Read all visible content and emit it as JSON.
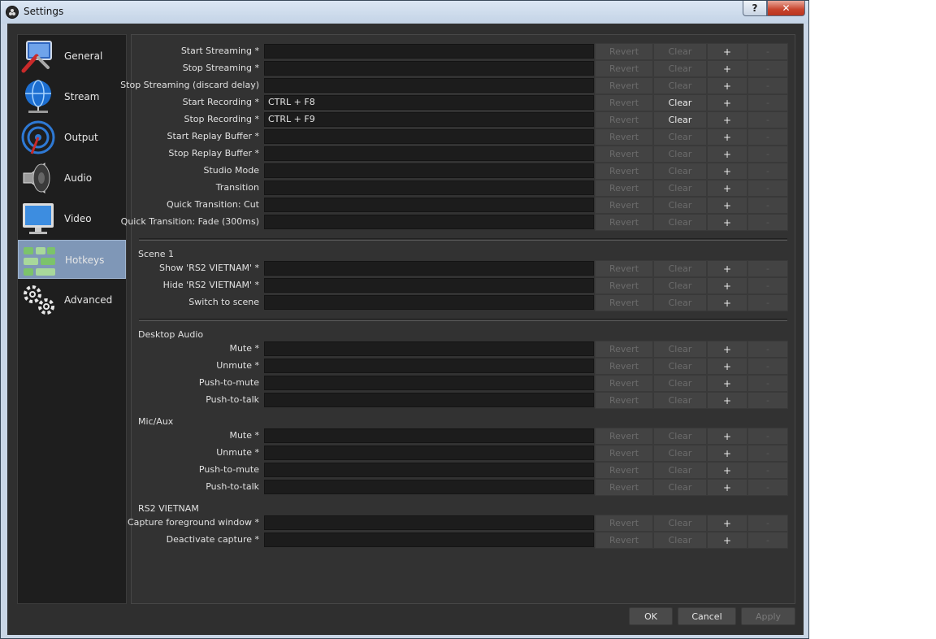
{
  "window": {
    "title": "Settings",
    "help_glyph": "?",
    "close_glyph": "✕"
  },
  "sidebar": {
    "items": [
      {
        "label": "General",
        "icon": "general-icon"
      },
      {
        "label": "Stream",
        "icon": "globe-icon"
      },
      {
        "label": "Output",
        "icon": "output-icon"
      },
      {
        "label": "Audio",
        "icon": "speaker-icon"
      },
      {
        "label": "Video",
        "icon": "monitor-icon"
      },
      {
        "label": "Hotkeys",
        "icon": "hotkeys-icon"
      },
      {
        "label": "Advanced",
        "icon": "gears-icon"
      }
    ],
    "selected": "Hotkeys"
  },
  "buttons": {
    "revert": "Revert",
    "clear": "Clear",
    "add": "+",
    "remove": "-"
  },
  "hotkeys": {
    "general": [
      {
        "label": "Start Streaming *",
        "value": "",
        "clear_enabled": false
      },
      {
        "label": "Stop Streaming *",
        "value": "",
        "clear_enabled": false
      },
      {
        "label": "Stop Streaming (discard delay)",
        "value": "",
        "clear_enabled": false
      },
      {
        "label": "Start Recording *",
        "value": "CTRL + F8",
        "clear_enabled": true
      },
      {
        "label": "Stop Recording *",
        "value": "CTRL + F9",
        "clear_enabled": true
      },
      {
        "label": "Start Replay Buffer *",
        "value": "",
        "clear_enabled": false
      },
      {
        "label": "Stop Replay Buffer *",
        "value": "",
        "clear_enabled": false
      },
      {
        "label": "Studio Mode",
        "value": "",
        "clear_enabled": false
      },
      {
        "label": "Transition",
        "value": "",
        "clear_enabled": false
      },
      {
        "label": "Quick Transition: Cut",
        "value": "",
        "clear_enabled": false
      },
      {
        "label": "Quick Transition: Fade (300ms)",
        "value": "",
        "clear_enabled": false
      }
    ],
    "scene": {
      "title": "Scene 1",
      "rows": [
        {
          "label": "Show 'RS2 VIETNAM' *",
          "value": ""
        },
        {
          "label": "Hide 'RS2 VIETNAM' *",
          "value": ""
        },
        {
          "label": "Switch to scene",
          "value": ""
        }
      ]
    },
    "desktop_audio": {
      "title": "Desktop Audio",
      "rows": [
        {
          "label": "Mute *",
          "value": ""
        },
        {
          "label": "Unmute *",
          "value": ""
        },
        {
          "label": "Push-to-mute",
          "value": ""
        },
        {
          "label": "Push-to-talk",
          "value": ""
        }
      ]
    },
    "mic_aux": {
      "title": "Mic/Aux",
      "rows": [
        {
          "label": "Mute *",
          "value": ""
        },
        {
          "label": "Unmute *",
          "value": ""
        },
        {
          "label": "Push-to-mute",
          "value": ""
        },
        {
          "label": "Push-to-talk",
          "value": ""
        }
      ]
    },
    "source": {
      "title": "RS2 VIETNAM",
      "rows": [
        {
          "label": "Capture foreground window *",
          "value": ""
        },
        {
          "label": "Deactivate capture *",
          "value": ""
        }
      ]
    }
  },
  "dialog_buttons": {
    "ok": "OK",
    "cancel": "Cancel",
    "apply": "Apply"
  }
}
